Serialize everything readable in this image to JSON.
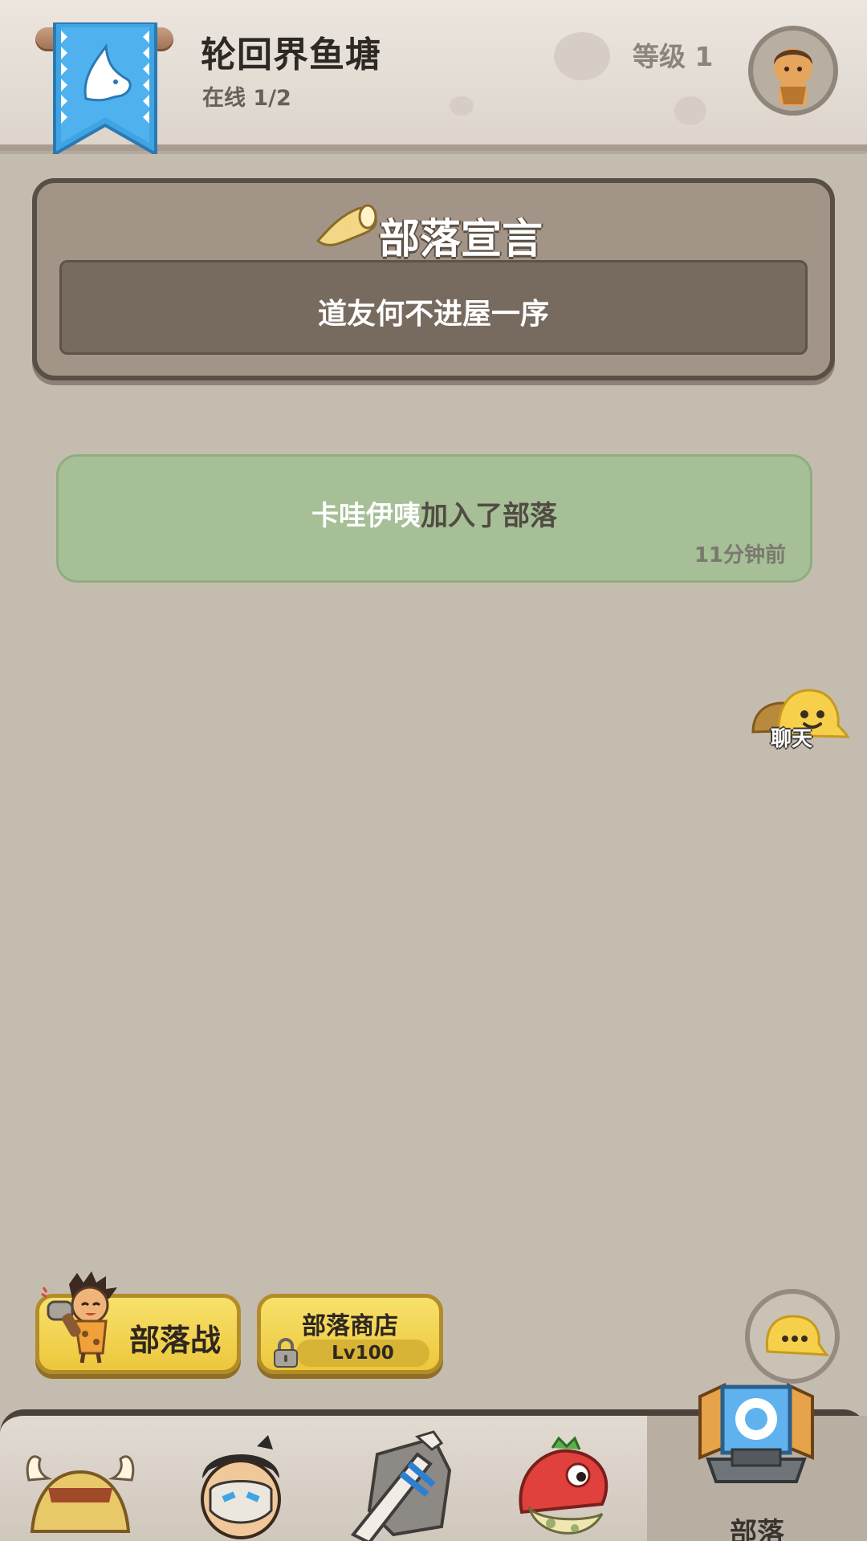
{
  "header": {
    "clan_name": "轮回界鱼塘",
    "online": "在线 1/2",
    "level": "等级 1"
  },
  "manifesto": {
    "title": "部落宣言",
    "text": "道友何不进屋一序"
  },
  "notice": {
    "user": "卡哇伊咦",
    "action": "加入了部落",
    "time": "11分钟前"
  },
  "chat_float": {
    "label": "聊天"
  },
  "actions": {
    "war_label": "部落战",
    "shop_label": "部落商店",
    "shop_level": "Lv100"
  },
  "nav": {
    "items": [
      {
        "icon": "caveman-hat-icon",
        "label": ""
      },
      {
        "icon": "masked-warrior-icon",
        "label": ""
      },
      {
        "icon": "stone-sword-icon",
        "label": ""
      },
      {
        "icon": "red-dino-icon",
        "label": ""
      },
      {
        "icon": "tribe-totem-icon",
        "label": "部落"
      }
    ]
  },
  "colors": {
    "background": "#c5bcb0",
    "banner_blue": "#3fa4e3",
    "notice_green": "#a6bf96",
    "button_yellow": "#f2d451"
  }
}
